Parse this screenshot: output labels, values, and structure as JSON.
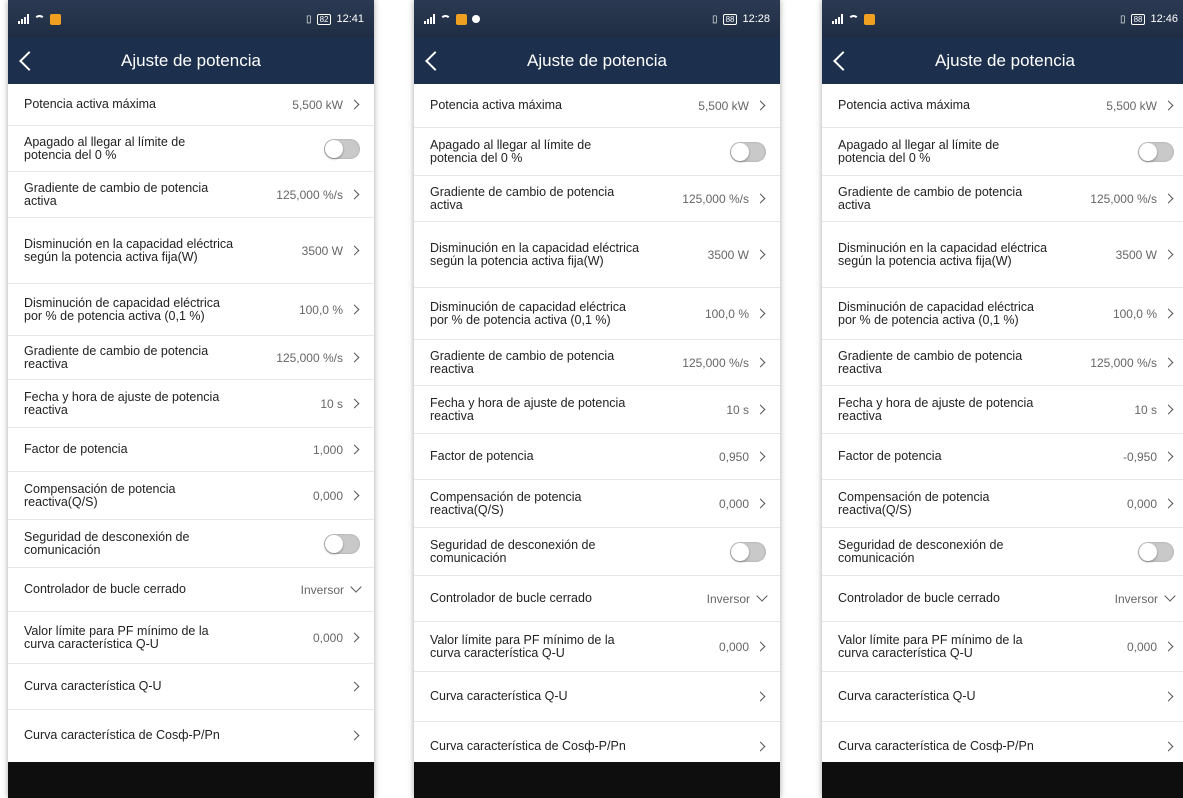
{
  "phones": [
    {
      "status_time": "12:41",
      "battery": "82",
      "title": "Ajuste de potencia",
      "rows": {
        "max_active_power": {
          "label": "Potencia activa máxima",
          "value": "5,500 kW"
        },
        "shutdown_limit": {
          "label": "Apagado al llegar al límite de potencia del 0 %",
          "toggle": "off"
        },
        "active_gradient": {
          "label": "Gradiente de cambio de potencia activa",
          "value": "125,000 %/s"
        },
        "fixed_derating": {
          "label": "Disminución en la capacidad eléctrica según la potencia activa fija(W)",
          "value": "3500 W"
        },
        "percent_derating": {
          "label": "Disminución de capacidad eléctrica por % de potencia activa (0,1 %)",
          "value": "100,0 %"
        },
        "reactive_gradient": {
          "label": "Gradiente de cambio de potencia reactiva",
          "value": "125,000 %/s"
        },
        "reactive_adjust_time": {
          "label": "Fecha y hora de ajuste de potencia reactiva",
          "value": "10 s"
        },
        "power_factor": {
          "label": "Factor de potencia",
          "value": "1,000"
        },
        "reactive_compensation": {
          "label": "Compensación de potencia reactiva(Q/S)",
          "value": "0,000"
        },
        "comm_disconnect": {
          "label": "Seguridad de desconexión de comunicación",
          "toggle": "off"
        },
        "closed_loop": {
          "label": "Controlador de bucle cerrado",
          "value": "Inversor"
        },
        "pf_limit": {
          "label": "Valor límite para PF mínimo de la curva característica Q-U",
          "value": "0,000"
        },
        "qu_curve": {
          "label": "Curva característica Q-U"
        },
        "cosphi_curve": {
          "label": "Curva característica de Cosф-P/Pn"
        }
      }
    },
    {
      "status_time": "12:28",
      "battery": "88",
      "title": "Ajuste de potencia",
      "rows": {
        "max_active_power": {
          "label": "Potencia activa máxima",
          "value": "5,500 kW"
        },
        "shutdown_limit": {
          "label": "Apagado al llegar al límite de potencia del 0 %",
          "toggle": "off"
        },
        "active_gradient": {
          "label": "Gradiente de cambio de potencia activa",
          "value": "125,000 %/s"
        },
        "fixed_derating": {
          "label": "Disminución en la capacidad eléctrica según la potencia activa fija(W)",
          "value": "3500 W"
        },
        "percent_derating": {
          "label": "Disminución de capacidad eléctrica por % de potencia activa (0,1 %)",
          "value": "100,0 %"
        },
        "reactive_gradient": {
          "label": "Gradiente de cambio de potencia reactiva",
          "value": "125,000 %/s"
        },
        "reactive_adjust_time": {
          "label": "Fecha y hora de ajuste de potencia reactiva",
          "value": "10 s"
        },
        "power_factor": {
          "label": "Factor de potencia",
          "value": "0,950"
        },
        "reactive_compensation": {
          "label": "Compensación de potencia reactiva(Q/S)",
          "value": "0,000"
        },
        "comm_disconnect": {
          "label": "Seguridad de desconexión de comunicación",
          "toggle": "off"
        },
        "closed_loop": {
          "label": "Controlador de bucle cerrado",
          "value": "Inversor"
        },
        "pf_limit": {
          "label": "Valor límite para PF mínimo de la curva característica Q-U",
          "value": "0,000"
        },
        "qu_curve": {
          "label": "Curva característica Q-U"
        },
        "cosphi_curve": {
          "label": "Curva característica de Cosф-P/Pn"
        }
      }
    },
    {
      "status_time": "12:46",
      "battery": "88",
      "title": "Ajuste de potencia",
      "rows": {
        "max_active_power": {
          "label": "Potencia activa máxima",
          "value": "5,500 kW"
        },
        "shutdown_limit": {
          "label": "Apagado al llegar al límite de potencia del 0 %",
          "toggle": "off"
        },
        "active_gradient": {
          "label": "Gradiente de cambio de potencia activa",
          "value": "125,000 %/s"
        },
        "fixed_derating": {
          "label": "Disminución en la capacidad eléctrica según la potencia activa fija(W)",
          "value": "3500 W"
        },
        "percent_derating": {
          "label": "Disminución de capacidad eléctrica por % de potencia activa (0,1 %)",
          "value": "100,0 %"
        },
        "reactive_gradient": {
          "label": "Gradiente de cambio de potencia reactiva",
          "value": "125,000 %/s"
        },
        "reactive_adjust_time": {
          "label": "Fecha y hora de ajuste de potencia reactiva",
          "value": "10 s"
        },
        "power_factor": {
          "label": "Factor de potencia",
          "value": "-0,950"
        },
        "reactive_compensation": {
          "label": "Compensación de potencia reactiva(Q/S)",
          "value": "0,000"
        },
        "comm_disconnect": {
          "label": "Seguridad de desconexión de comunicación",
          "toggle": "off"
        },
        "closed_loop": {
          "label": "Controlador de bucle cerrado",
          "value": "Inversor"
        },
        "pf_limit": {
          "label": "Valor límite para PF mínimo de la curva característica Q-U",
          "value": "0,000"
        },
        "qu_curve": {
          "label": "Curva característica Q-U"
        },
        "cosphi_curve": {
          "label": "Curva característica de Cosф-P/Pn"
        }
      }
    }
  ],
  "colors": {
    "appbar": "#1c2f4d",
    "statusbar": "#2b3a52",
    "toggle_off": "#c9c9c9"
  }
}
